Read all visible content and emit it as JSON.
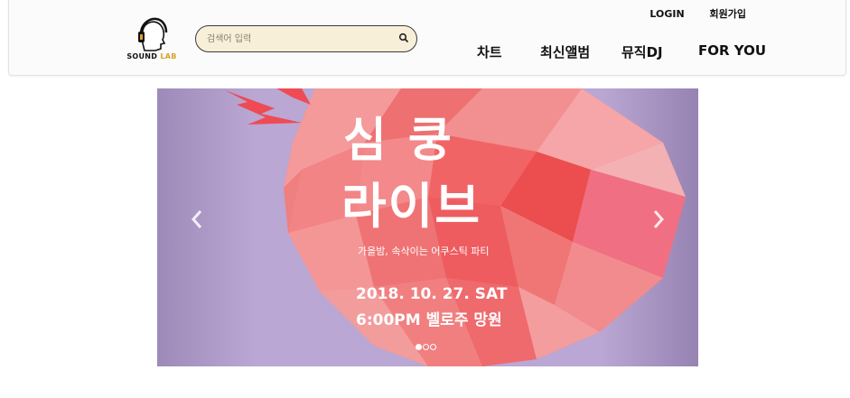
{
  "logo": {
    "brand": "SOUND",
    "brand_accent": "LAB"
  },
  "search": {
    "placeholder": "검색어 입력",
    "icon": "search-icon"
  },
  "top_links": {
    "login": "LOGIN",
    "signup": "회원가입"
  },
  "nav": {
    "items": [
      "차트",
      "최신앨범",
      "뮤직DJ",
      "FOR YOU"
    ]
  },
  "banner": {
    "title_line1": "심쿵",
    "title_line2": "라이브",
    "subtitle": "가을밤, 속삭이는 어쿠스틱 파티",
    "date": "2018. 10. 27. SAT",
    "place": "6:00PM 벨로주 망원",
    "prev_icon": "chevron-left-icon",
    "next_icon": "chevron-right-icon",
    "slide_count": 3,
    "active_slide": 1,
    "colors": {
      "background": "#b8a4d0",
      "heart": "#f07070",
      "accent": "#ee4b55"
    }
  }
}
